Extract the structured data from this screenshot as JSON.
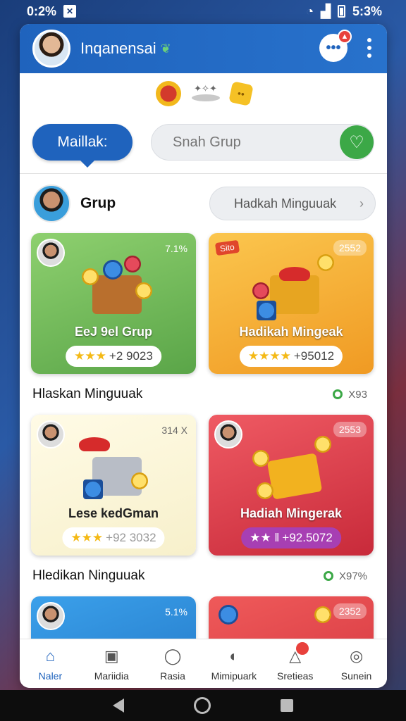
{
  "status": {
    "time": "0:2%",
    "right_text": "5:3%"
  },
  "header": {
    "title": "Inqanensai",
    "title_icon": "leaf-icon",
    "chat_icon": "chat-bubble-icon",
    "chat_badge_icon": "triangle-icon",
    "menu_icon": "kebab-menu-icon"
  },
  "search": {
    "button_label": "Maillak:",
    "placeholder": "Snah Grup",
    "action_icon": "heart-icon"
  },
  "group": {
    "title": "Grup",
    "button_label": "Hadkah Minguuak"
  },
  "tiles": [
    {
      "title": "EeJ 9el Grup",
      "stat": "7.1%",
      "score": "+2 9023",
      "stars": "★★★"
    },
    {
      "title": "Hadikah Mingeak",
      "stat": "2552",
      "tag": "Sito",
      "score": "+95012",
      "stars": "★★★★"
    },
    {
      "title": "Lese kedGman",
      "stat": "314 X",
      "score": "+92 3032",
      "stars": "★★★"
    },
    {
      "title": "Hadiah Mingerak",
      "stat": "2553",
      "score": "+92.5072",
      "stars": "★★ ‖"
    },
    {
      "title": "",
      "stat": "5.1%",
      "score": "",
      "stars": ""
    },
    {
      "title": "",
      "stat": "2352",
      "score": "",
      "stars": ""
    }
  ],
  "sections": [
    {
      "title": "Hlaskan Minguuak",
      "stat": "X93"
    },
    {
      "title": "Hledikan Ninguuak",
      "stat": "X97%"
    }
  ],
  "tabs": [
    {
      "label": "Naler",
      "icon": "home-icon",
      "active": true
    },
    {
      "label": "Mariidia",
      "icon": "media-icon",
      "active": false
    },
    {
      "label": "Rasia",
      "icon": "person-icon",
      "active": false
    },
    {
      "label": "Mimipuark",
      "icon": "compass-icon",
      "active": false
    },
    {
      "label": "Sretieas",
      "icon": "notification-icon",
      "active": false
    },
    {
      "label": "Sunein",
      "icon": "profile-icon",
      "active": false
    }
  ]
}
